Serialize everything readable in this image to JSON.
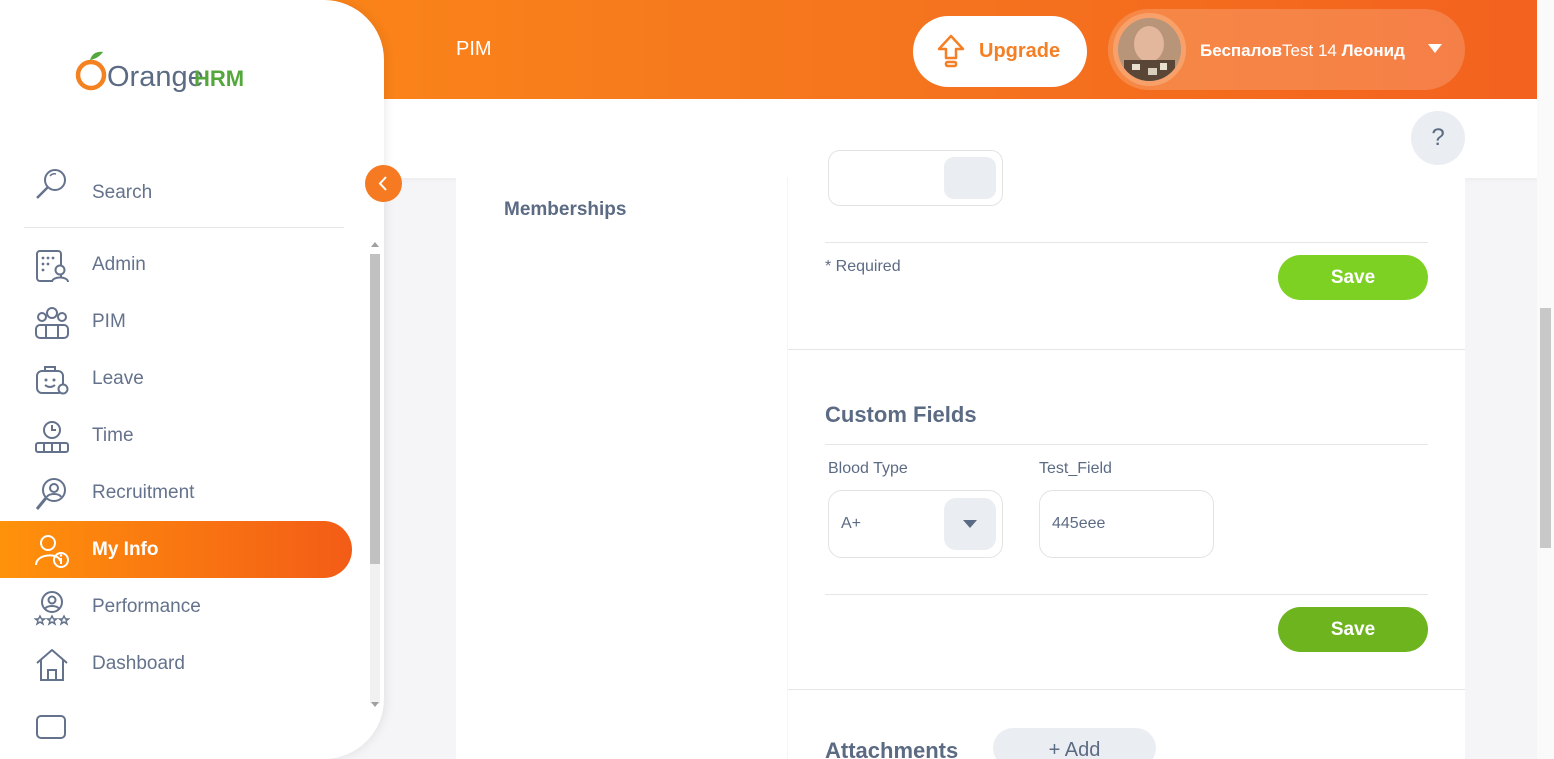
{
  "header": {
    "module_title": "PIM",
    "upgrade_label": "Upgrade",
    "user_name_first": "Беспалов",
    "user_name_mid": "Test 14",
    "user_name_last": "Леонид",
    "help_label": "?"
  },
  "sidebar": {
    "brand_orange": "Orange",
    "brand_hrm": "HRM",
    "search_label": "Search",
    "items": [
      {
        "label": "Admin",
        "icon": "admin-icon"
      },
      {
        "label": "PIM",
        "icon": "pim-icon"
      },
      {
        "label": "Leave",
        "icon": "leave-icon"
      },
      {
        "label": "Time",
        "icon": "time-icon"
      },
      {
        "label": "Recruitment",
        "icon": "recruitment-icon"
      },
      {
        "label": "My Info",
        "icon": "my-info-icon",
        "active": true
      },
      {
        "label": "Performance",
        "icon": "performance-icon"
      },
      {
        "label": "Dashboard",
        "icon": "dashboard-icon"
      }
    ]
  },
  "tabs": {
    "memberships": "Memberships"
  },
  "form": {
    "required_note": "* Required",
    "save_label": "Save"
  },
  "custom_fields": {
    "title": "Custom Fields",
    "blood_type_label": "Blood Type",
    "blood_type_value": "A+",
    "test_field_label": "Test_Field",
    "test_field_value": "445eee",
    "save_label": "Save"
  },
  "attachments": {
    "title": "Attachments",
    "add_label": "+ Add"
  },
  "colors": {
    "accent": "#f57a22",
    "save_green": "#7cc623",
    "save_green_dark": "#6db41f",
    "text": "#64728c"
  }
}
